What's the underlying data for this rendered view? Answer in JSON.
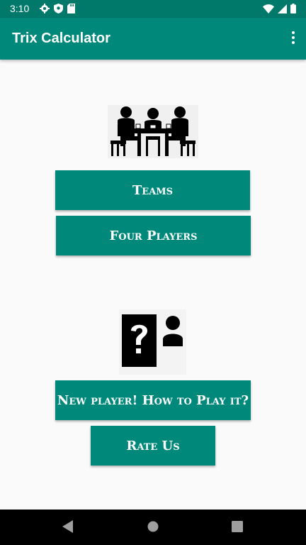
{
  "status_bar": {
    "time": "3:10",
    "icons": [
      "gear-icon",
      "shield-icon",
      "sd-card-icon",
      "wifi-icon",
      "signal-icon",
      "battery-icon"
    ]
  },
  "app_bar": {
    "title": "Trix Calculator",
    "menu_icon": "more-vert-icon",
    "color": "#00897b",
    "status_color": "#00796b"
  },
  "illustrations": {
    "players_table": "players-at-table-icon",
    "help_card": "question-card-person-icon"
  },
  "buttons": {
    "teams": "Teams",
    "four_players": "Four Players",
    "how_to_play": "New player! How to Play it?",
    "rate_us": "Rate Us"
  },
  "nav_bar": {
    "back": "back-icon",
    "home": "home-icon",
    "recents": "recents-icon"
  }
}
